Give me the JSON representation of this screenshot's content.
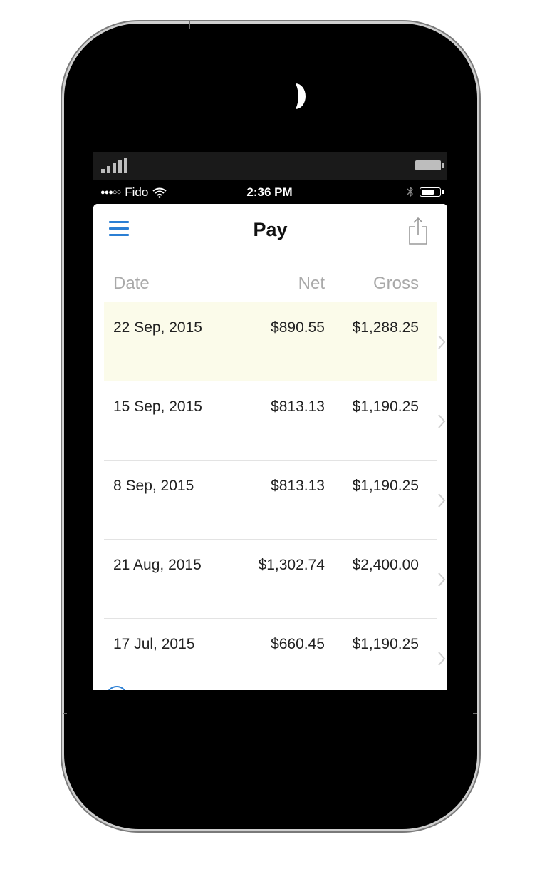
{
  "colors": {
    "accent": "#2b7fd4",
    "highlight_row": "#fbfbea",
    "header_text": "#a9a9a9"
  },
  "status_bar": {
    "carrier": "Fido",
    "time": "2:36 PM",
    "signal_dots": "●●●○○",
    "icons": [
      "wifi-icon",
      "bluetooth-icon",
      "battery-icon"
    ]
  },
  "navbar": {
    "title": "Pay",
    "left_icon": "hamburger-menu-icon",
    "right_icon": "share-icon"
  },
  "table": {
    "columns": [
      "Date",
      "Net",
      "Gross"
    ],
    "rows": [
      {
        "date": "22 Sep, 2015",
        "net": "$890.55",
        "gross": "$1,288.25",
        "highlighted": true
      },
      {
        "date": "15 Sep, 2015",
        "net": "$813.13",
        "gross": "$1,190.25",
        "highlighted": false
      },
      {
        "date": "8 Sep, 2015",
        "net": "$813.13",
        "gross": "$1,190.25",
        "highlighted": false
      },
      {
        "date": "21 Aug, 2015",
        "net": "$1,302.74",
        "gross": "$2,400.00",
        "highlighted": false
      },
      {
        "date": "17 Jul, 2015",
        "net": "$660.45",
        "gross": "$1,190.25",
        "highlighted": false
      }
    ]
  }
}
